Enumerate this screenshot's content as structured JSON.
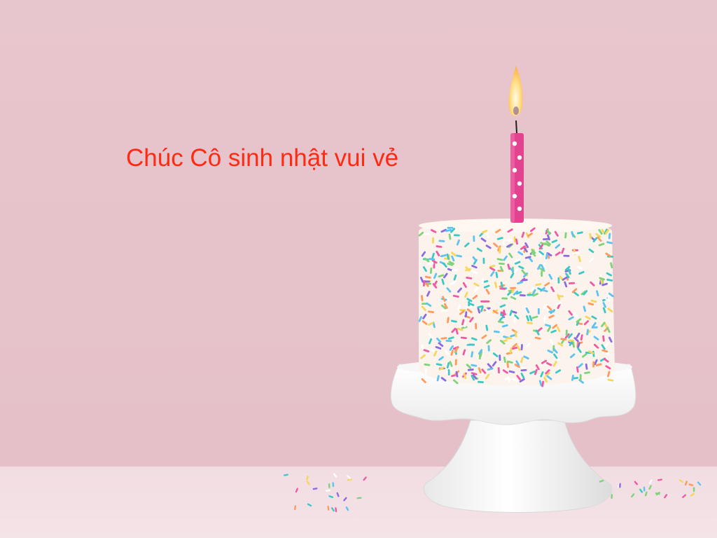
{
  "greeting": {
    "text": "Chúc Cô sinh nhật vui vẻ",
    "color": "#ff2a12"
  },
  "palette": {
    "background": "#e8c6cd",
    "table": "#f3e1e5",
    "stand": "#ffffff",
    "candle": "#e3428f",
    "flame": "#ffd46a",
    "sprinkles": [
      "#3ec8c4",
      "#f05aa4",
      "#f6d65b",
      "#7fd37a",
      "#ff9a5c",
      "#8a6be0",
      "#5ec3f0",
      "#ffffff"
    ]
  }
}
